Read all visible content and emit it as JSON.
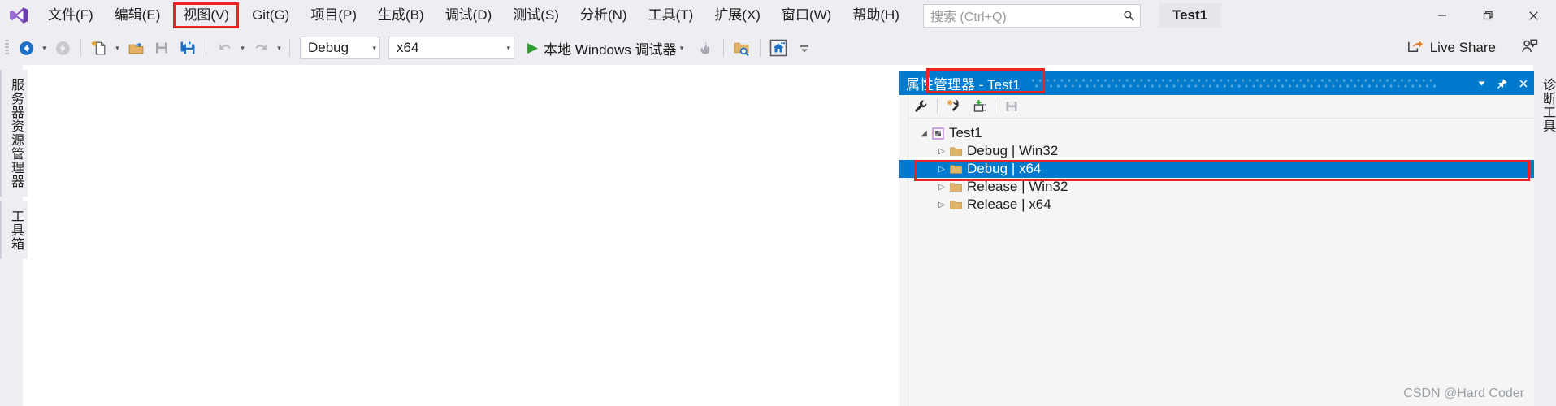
{
  "titlebar": {
    "logo_icon": "visual-studio-logo",
    "menus": [
      {
        "label": "文件(F)",
        "boxed": false
      },
      {
        "label": "编辑(E)",
        "boxed": false
      },
      {
        "label": "视图(V)",
        "boxed": true
      },
      {
        "label": "Git(G)",
        "boxed": false
      },
      {
        "label": "项目(P)",
        "boxed": false
      },
      {
        "label": "生成(B)",
        "boxed": false
      },
      {
        "label": "调试(D)",
        "boxed": false
      },
      {
        "label": "测试(S)",
        "boxed": false
      },
      {
        "label": "分析(N)",
        "boxed": false
      },
      {
        "label": "工具(T)",
        "boxed": false
      },
      {
        "label": "扩展(X)",
        "boxed": false
      },
      {
        "label": "窗口(W)",
        "boxed": false
      },
      {
        "label": "帮助(H)",
        "boxed": false
      }
    ],
    "search": {
      "placeholder": "搜索 (Ctrl+Q)",
      "value": "",
      "icon": "search-icon"
    },
    "project_chip": "Test1",
    "window_buttons": [
      {
        "name": "minimize-button",
        "glyph": "—"
      },
      {
        "name": "restore-button",
        "glyph": "❐"
      },
      {
        "name": "close-button",
        "glyph": "✕"
      }
    ]
  },
  "toolbar": {
    "navigate_back": "后退",
    "navigate_forward": "前进",
    "new_item": "新建项",
    "open_file": "打开文件",
    "save": "保存",
    "save_all": "全部保存",
    "undo": "撤消",
    "redo": "恢复",
    "configuration": {
      "value": "Debug",
      "caret": "▾"
    },
    "platform": {
      "value": "x64",
      "caret": "▾"
    },
    "run_label": "本地 Windows 调试器",
    "run_arrow": "▶",
    "hot_reload_icon": "flame-icon",
    "search_in_folder_icon": "folder-search-icon",
    "home_icon": "home-icon",
    "overflow_icon": "toolbar-overflow-icon",
    "live_share_label": "Live Share",
    "live_share_icon": "share-icon",
    "feedback_icon": "feedback-person-icon"
  },
  "rails": {
    "left": [
      "服务器资源管理器",
      "工具箱"
    ],
    "right": [
      "诊断工具"
    ]
  },
  "panel": {
    "title": "属性管理器 - Test1",
    "title_buttons": [
      {
        "name": "panel-dropdown-button",
        "glyph": "▾"
      },
      {
        "name": "panel-pin-button",
        "glyph": "pin-icon"
      },
      {
        "name": "panel-close-button",
        "glyph": "✕"
      }
    ],
    "toolbar_icons": [
      {
        "name": "properties-wrench-icon",
        "label": "属性"
      },
      {
        "name": "add-new-property-sheet-icon",
        "label": "添加新项目属性表"
      },
      {
        "name": "add-existing-property-sheet-icon",
        "label": "添加现有属性表"
      },
      {
        "name": "save-property-sheet-icon",
        "label": "保存"
      }
    ],
    "tree": {
      "root": {
        "label": "Test1",
        "expander": "◢",
        "icon": "project-icon"
      },
      "children": [
        {
          "label": "Debug | Win32",
          "expander": "▷",
          "icon": "folder-icon",
          "selected": false
        },
        {
          "label": "Debug | x64",
          "expander": "▷",
          "icon": "folder-icon",
          "selected": true
        },
        {
          "label": "Release | Win32",
          "expander": "▷",
          "icon": "folder-icon",
          "selected": false
        },
        {
          "label": "Release | x64",
          "expander": "▷",
          "icon": "folder-icon",
          "selected": false
        }
      ]
    }
  },
  "watermark": "CSDN @Hard Coder",
  "colors": {
    "accent_blue": "#007acc",
    "highlight_red": "#ee2222",
    "chrome_bg": "#eeeef2",
    "panel_bg": "#f5f5f5"
  }
}
